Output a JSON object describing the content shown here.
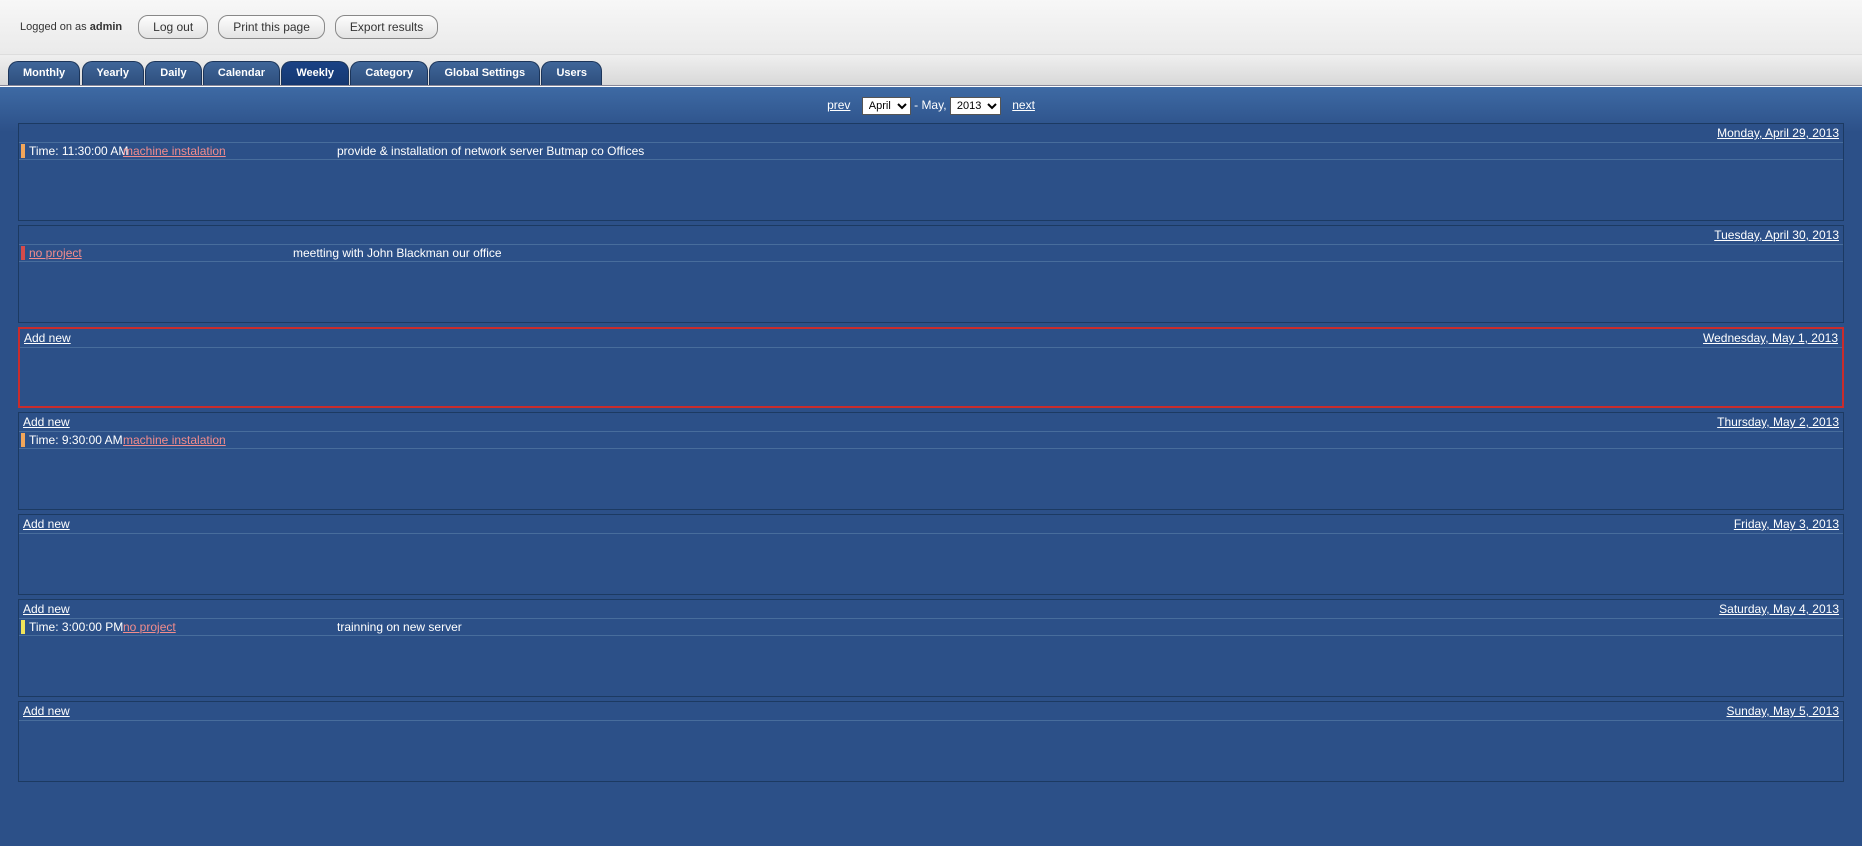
{
  "header": {
    "logged_prefix": "Logged on as ",
    "logged_user": "admin",
    "logout": "Log out",
    "print": "Print this page",
    "export": "Export results"
  },
  "tabs": {
    "monthly": "Monthly",
    "yearly": "Yearly",
    "daily": "Daily",
    "calendar": "Calendar",
    "weekly": "Weekly",
    "category": "Category",
    "global": "Global Settings",
    "users": "Users"
  },
  "nav": {
    "prev": "prev",
    "month": "April",
    "sep": " - May, ",
    "year": "2013",
    "next": "next"
  },
  "add_new": "Add new",
  "days": {
    "d0": {
      "label": "Monday, April 29, 2013",
      "evt_time": "Time: 11:30:00 AM",
      "evt_proj": " machine instalation",
      "evt_desc": "provide & installation of network server Butmap co Offices"
    },
    "d1": {
      "label": "Tuesday, April 30, 2013",
      "evt_proj": " no project",
      "evt_desc": "meetting with John Blackman our office"
    },
    "d2": {
      "label": "Wednesday, May 1, 2013"
    },
    "d3": {
      "label": "Thursday, May 2, 2013",
      "evt_time": "Time: 9:30:00 AM",
      "evt_proj": " machine instalation"
    },
    "d4": {
      "label": "Friday, May 3, 2013"
    },
    "d5": {
      "label": "Saturday, May 4, 2013",
      "evt_time": "Time: 3:00:00 PM",
      "evt_proj": " no project",
      "evt_desc": "trainning on new server"
    },
    "d6": {
      "label": "Sunday, May 5, 2013"
    }
  }
}
